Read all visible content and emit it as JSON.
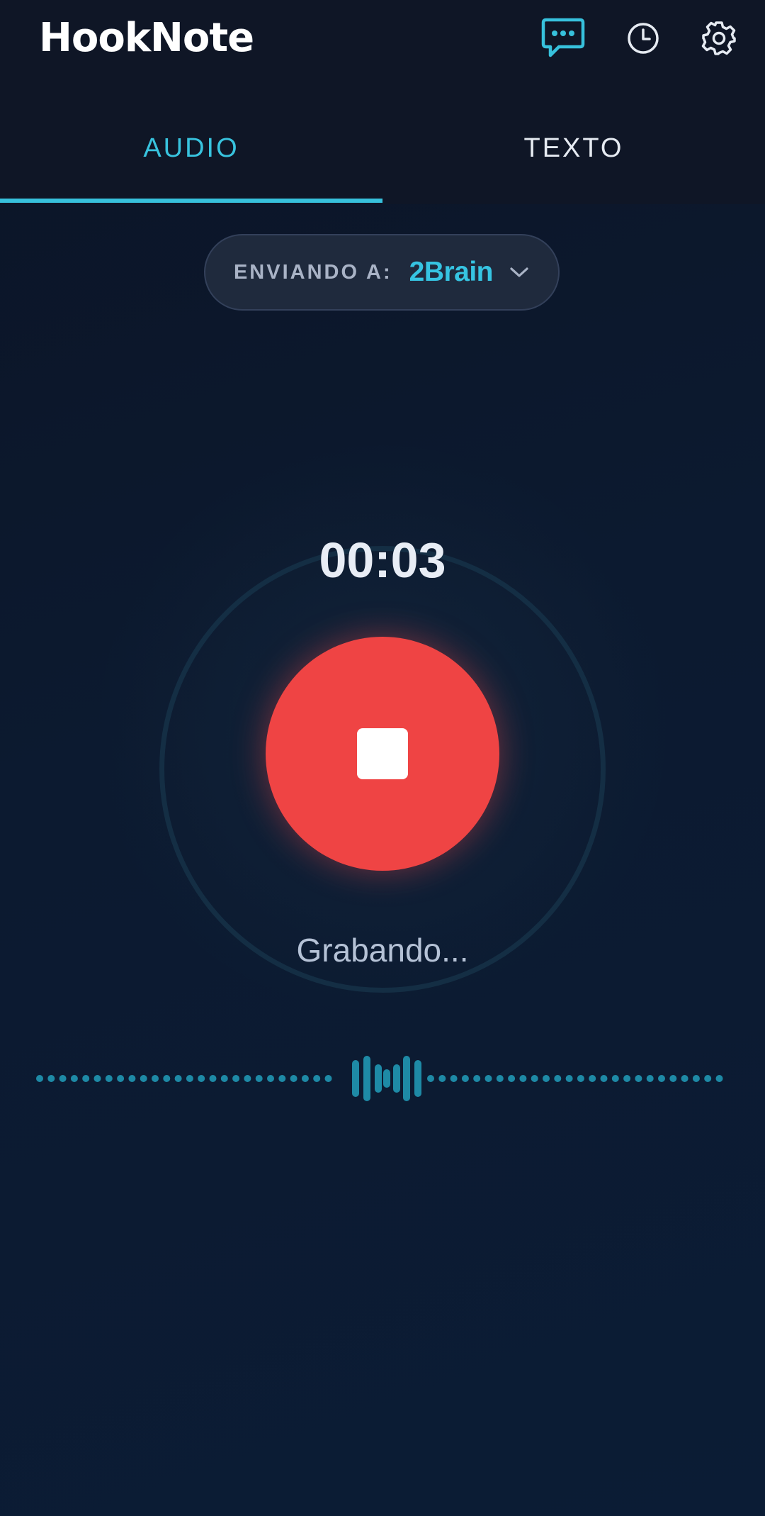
{
  "header": {
    "title": "HookNote",
    "icons": [
      "chat-icon",
      "history-icon",
      "settings-icon"
    ]
  },
  "tabs": [
    {
      "label": "AUDIO",
      "active": true
    },
    {
      "label": "TEXTO",
      "active": false
    }
  ],
  "destination": {
    "label": "ENVIANDO A:",
    "value": "2Brain",
    "icon": "chevron-down-icon"
  },
  "recorder": {
    "timer": "00:03",
    "status": "Grabando...",
    "button_icon": "stop-icon"
  },
  "colors": {
    "accent": "#37c1dc",
    "record": "#ef4444",
    "background": "#0c1628",
    "header": "#0f1626"
  }
}
